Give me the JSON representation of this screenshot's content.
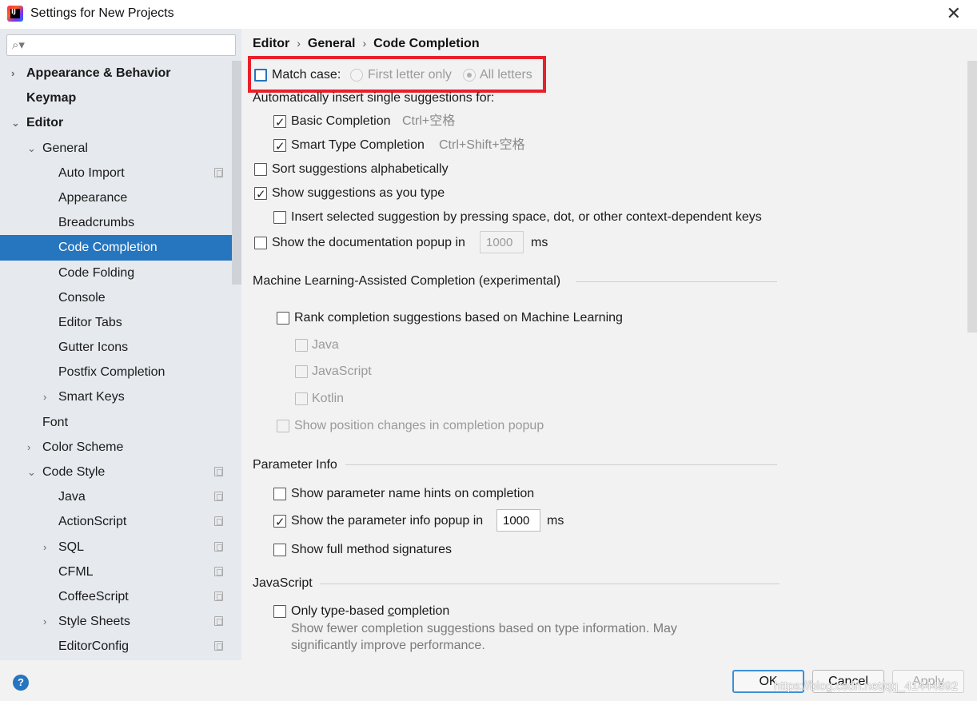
{
  "window": {
    "title": "Settings for New Projects",
    "close_glyph": "✕"
  },
  "search": {
    "glyph": "⌕▾",
    "placeholder": ""
  },
  "sidebar": {
    "items": [
      {
        "label": "Appearance & Behavior",
        "chevron": "›",
        "bold": true
      },
      {
        "label": "Keymap",
        "bold": true
      },
      {
        "label": "Editor",
        "chevron": "⌄",
        "bold": true
      },
      {
        "label": "General",
        "chevron": "⌄"
      },
      {
        "label": "Auto Import",
        "copy_icon": true
      },
      {
        "label": "Appearance"
      },
      {
        "label": "Breadcrumbs"
      },
      {
        "label": "Code Completion",
        "selected": true
      },
      {
        "label": "Code Folding"
      },
      {
        "label": "Console"
      },
      {
        "label": "Editor Tabs"
      },
      {
        "label": "Gutter Icons"
      },
      {
        "label": "Postfix Completion"
      },
      {
        "label": "Smart Keys",
        "chevron": "›"
      },
      {
        "label": "Font"
      },
      {
        "label": "Color Scheme",
        "chevron": "›"
      },
      {
        "label": "Code Style",
        "chevron": "⌄",
        "copy_icon": true
      },
      {
        "label": "Java",
        "copy_icon": true
      },
      {
        "label": "ActionScript",
        "copy_icon": true
      },
      {
        "label": "SQL",
        "chevron": "›",
        "copy_icon": true
      },
      {
        "label": "CFML",
        "copy_icon": true
      },
      {
        "label": "CoffeeScript",
        "copy_icon": true
      },
      {
        "label": "Style Sheets",
        "chevron": "›",
        "copy_icon": true
      },
      {
        "label": "EditorConfig",
        "copy_icon": true
      }
    ]
  },
  "breadcrumb": {
    "items": [
      "Editor",
      "General",
      "Code Completion"
    ],
    "separator": "›"
  },
  "match_case": {
    "label": "Match case:",
    "checked": false,
    "first_letter": "First letter only",
    "all_letters": "All letters",
    "selected": "All letters"
  },
  "auto_insert": {
    "title": "Automatically insert single suggestions for:",
    "basic": {
      "label": "Basic Completion",
      "shortcut": "Ctrl+空格",
      "checked": true
    },
    "smart": {
      "label": "Smart Type Completion",
      "shortcut": "Ctrl+Shift+空格",
      "checked": true
    }
  },
  "sort_alpha": {
    "label": "Sort suggestions alphabetically",
    "checked": false
  },
  "show_as_type": {
    "label": "Show suggestions as you type",
    "checked": true
  },
  "insert_selected": {
    "label": "Insert selected suggestion by pressing space, dot, or other context-dependent keys",
    "checked": false
  },
  "doc_popup": {
    "label": "Show the documentation popup in",
    "value": "1000",
    "unit": "ms",
    "checked": false
  },
  "ml": {
    "title": "Machine Learning-Assisted Completion (experimental)",
    "rank": {
      "label": "Rank completion suggestions based on Machine Learning",
      "checked": false
    },
    "languages": [
      "Java",
      "JavaScript",
      "Kotlin"
    ],
    "position": {
      "label": "Show position changes in completion popup",
      "checked": false
    }
  },
  "param_info": {
    "title": "Parameter Info",
    "name_hints": {
      "label": "Show parameter name hints on completion",
      "checked": false
    },
    "info_popup": {
      "label": "Show the parameter info popup in",
      "value": "1000",
      "unit": "ms",
      "checked": true
    },
    "full_sig": {
      "label": "Show full method signatures",
      "checked": false
    }
  },
  "javascript": {
    "title": "JavaScript",
    "type_based_pre": "Only type-based ",
    "type_based_u": "c",
    "type_based_post": "ompletion",
    "checked": false,
    "description": "Show fewer completion suggestions based on type information. May significantly improve performance."
  },
  "footer": {
    "help": "?",
    "ok": "OK",
    "cancel": "Cancel",
    "apply": "Apply",
    "watermark": "https://blog.csdn.net/qq_41444892"
  },
  "colors": {
    "accent": "#2675bf",
    "highlight_box": "#e8202a",
    "sidebar_bg": "#e6e9ee"
  }
}
